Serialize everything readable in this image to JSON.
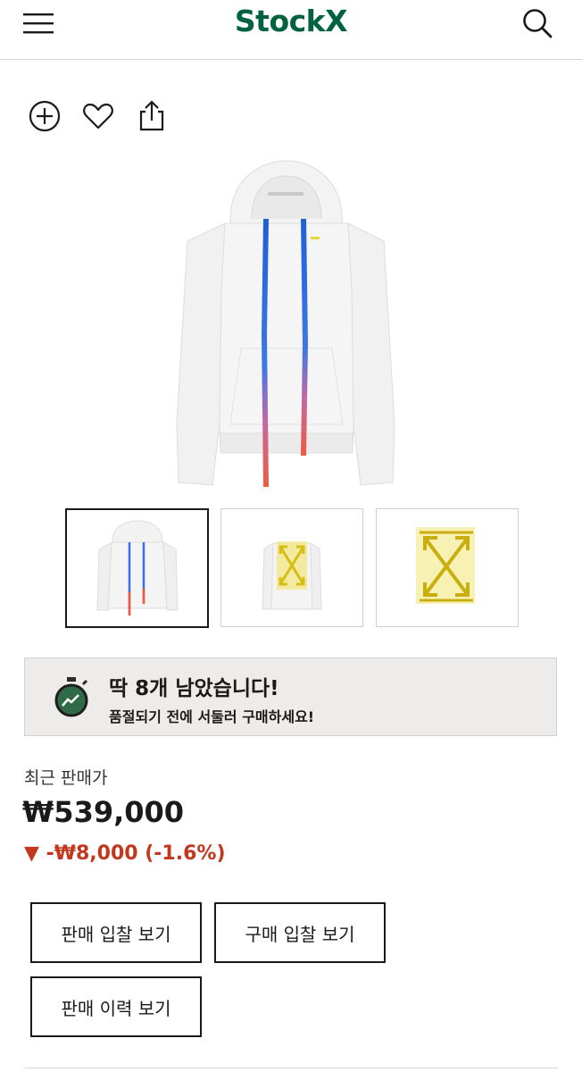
{
  "header": {
    "logo_text": "Stock",
    "logo_x": "X"
  },
  "icons": [
    "menu-icon",
    "search-icon",
    "add-icon",
    "heart-icon",
    "share-icon",
    "timer-icon"
  ],
  "colors": {
    "brand": "#006340",
    "price_drop": "#c4371c",
    "banner_bg": "#eeecea"
  },
  "stock_alert": {
    "title": "딱 8개 남았습니다!",
    "subtitle": "품절되기 전에 서둘러 구매하세요!"
  },
  "price": {
    "label": "최근 판매가",
    "value": "₩539,000",
    "change_arrow": "▼",
    "change": "-₩8,000 (-1.6%)"
  },
  "buttons": {
    "sell_bids": "판매 입찰 보기",
    "buy_bids": "구매 입찰 보기",
    "sales_history": "판매 이력 보기"
  },
  "thumbnails": {
    "count": 3,
    "selected_index": 0
  }
}
